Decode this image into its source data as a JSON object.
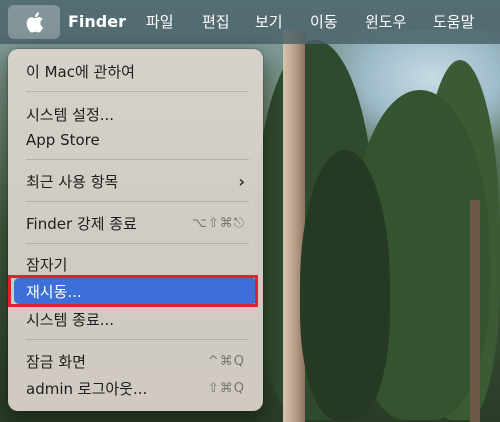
{
  "menubar": {
    "app_name": "Finder",
    "items": [
      "파일",
      "편집",
      "보기",
      "이동",
      "윈도우",
      "도움말"
    ]
  },
  "apple_menu": {
    "about": "이 Mac에 관하여",
    "settings": "시스템 설정...",
    "app_store": "App Store",
    "recent": "최근 사용 항목",
    "force_quit": "Finder 강제 종료",
    "force_quit_shortcut": "⌥⇧⌘⎋",
    "sleep": "잠자기",
    "restart": "재시동...",
    "shutdown": "시스템 종료...",
    "lock": "잠금 화면",
    "lock_shortcut": "^⌘Q",
    "logout": "admin 로그아웃...",
    "logout_shortcut": "⇧⌘Q"
  },
  "highlight_color": "#3d6fd8",
  "annotation_color": "#e02033"
}
